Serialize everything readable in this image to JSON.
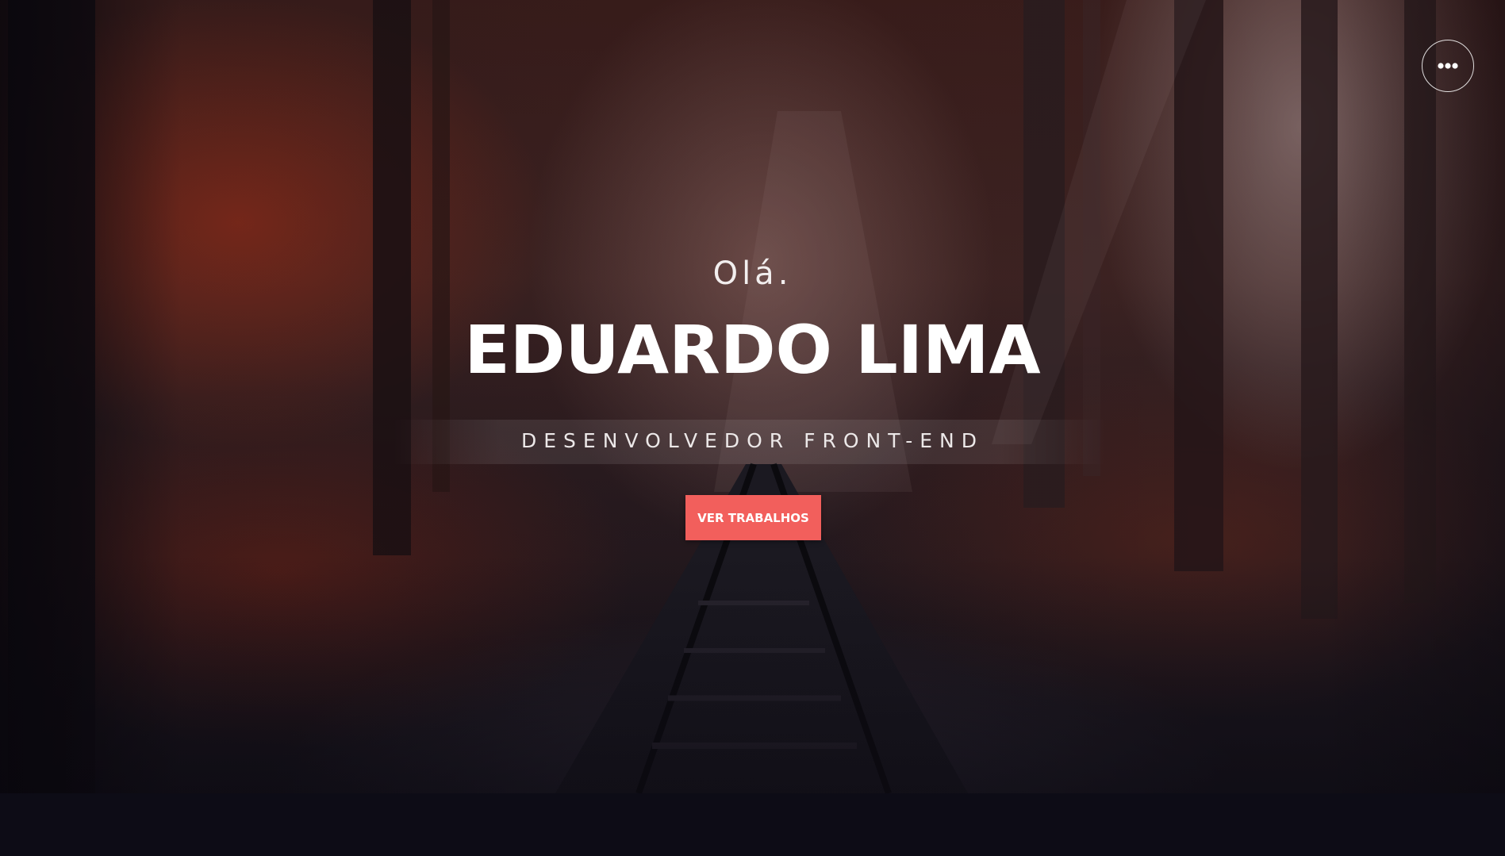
{
  "hero": {
    "greeting": "Olá.",
    "name": "EDUARDO LIMA",
    "role": "DESENVOLVEDOR FRONT-END",
    "cta_label": "VER TRABALHOS"
  },
  "menu": {
    "icon": "more-horizontal-icon"
  },
  "colors": {
    "accent": "#f25f5c",
    "page_background": "#0d0c16",
    "text": "#ffffff"
  }
}
